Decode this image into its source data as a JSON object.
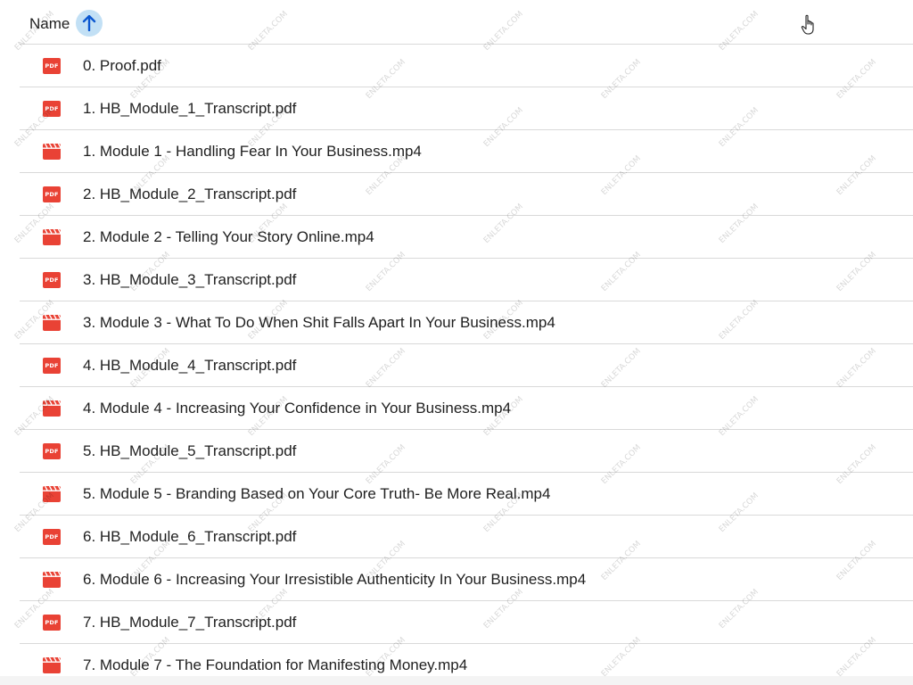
{
  "header": {
    "column_label": "Name",
    "sort_icon": "arrow-up-icon",
    "sort_direction": "ascending"
  },
  "files": [
    {
      "name": "0. Proof.pdf",
      "type": "pdf"
    },
    {
      "name": "1. HB_Module_1_Transcript.pdf",
      "type": "pdf"
    },
    {
      "name": "1. Module 1 - Handling Fear In Your Business.mp4",
      "type": "video"
    },
    {
      "name": "2. HB_Module_2_Transcript.pdf",
      "type": "pdf"
    },
    {
      "name": "2. Module 2 - Telling Your Story Online.mp4",
      "type": "video"
    },
    {
      "name": "3. HB_Module_3_Transcript.pdf",
      "type": "pdf"
    },
    {
      "name": "3. Module 3 - What To Do When Shit Falls Apart In Your Business.mp4",
      "type": "video"
    },
    {
      "name": "4. HB_Module_4_Transcript.pdf",
      "type": "pdf"
    },
    {
      "name": "4. Module 4 - Increasing Your Confidence in Your Business.mp4",
      "type": "video"
    },
    {
      "name": "5. HB_Module_5_Transcript.pdf",
      "type": "pdf"
    },
    {
      "name": "5. Module 5 - Branding Based on Your Core Truth- Be More Real.mp4",
      "type": "video"
    },
    {
      "name": "6. HB_Module_6_Transcript.pdf",
      "type": "pdf"
    },
    {
      "name": "6. Module 6 - Increasing Your Irresistible Authenticity In Your Business.mp4",
      "type": "video"
    },
    {
      "name": "7. HB_Module_7_Transcript.pdf",
      "type": "pdf"
    },
    {
      "name": "7. Module 7 - The Foundation for Manifesting Money.mp4",
      "type": "video"
    }
  ],
  "icons": {
    "pdf": {
      "name": "pdf-icon",
      "label": "PDF",
      "color": "#e94235"
    },
    "video": {
      "name": "video-icon",
      "color": "#e94235"
    }
  },
  "watermark_text": "ENLETA.COM",
  "colors": {
    "sort_button_bg": "#c2e0f5",
    "sort_arrow": "#0b57d0",
    "divider": "#d9d9d9"
  }
}
